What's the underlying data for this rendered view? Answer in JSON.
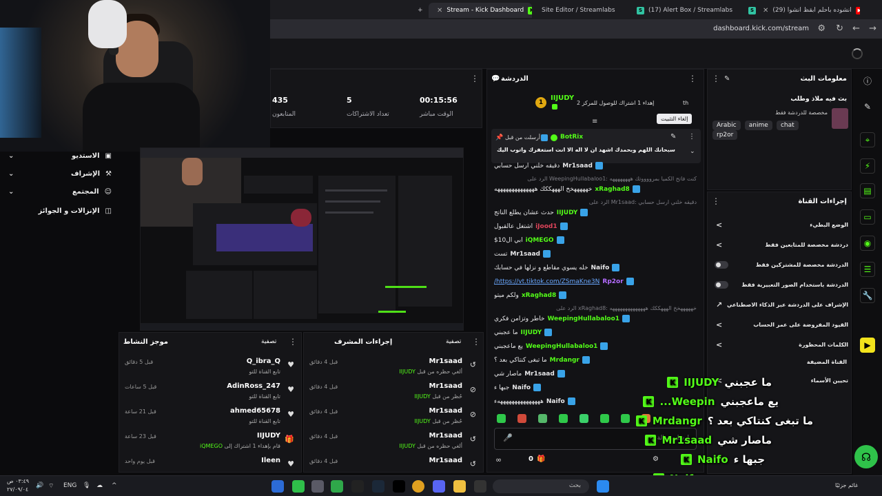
{
  "browser": {
    "tabs": [
      {
        "label": "Stream - Kick Dashboard",
        "favicon": "K",
        "active": true
      },
      {
        "label": "Site Editor / Streamlabs",
        "favicon": "S",
        "active": false
      },
      {
        "label": "(17) Alert Box / Streamlabs",
        "favicon": "S",
        "active": false
      },
      {
        "label": "(29) انشوده باحلم ابقظ انشوا",
        "favicon": "▶",
        "active": false
      }
    ],
    "new_tab": "+",
    "url": "dashboard.kick.com/stream"
  },
  "left_nav": {
    "items": [
      {
        "label": "الاستديو",
        "icon": "studio-icon"
      },
      {
        "label": "الإشراف",
        "icon": "moderation-icon"
      },
      {
        "label": "المجتمع",
        "icon": "community-icon"
      },
      {
        "label": "الإنزالات و الجوائز",
        "icon": "drops-icon"
      }
    ]
  },
  "stats": {
    "viewers": {
      "value": "435",
      "label": "المتابعون"
    },
    "subs": {
      "value": "5",
      "label": "تعداد الاشتراكات"
    },
    "uptime": {
      "value": "00:15:56",
      "label": "الوقت مباشر"
    }
  },
  "chat": {
    "title": "الدردشة",
    "goal_user": "IIJUDY",
    "goal_text": "إهداء 1 اشتراك للوصول للمركز 2",
    "goal_suffix": "th",
    "goal_rank": "1",
    "pinned": {
      "prefix": "أرسلت من قبل:",
      "user": "BotRix",
      "text": "سبحانك اللهم وبحمدك اشهد ان لا اله الا انت استغفرك واتوب اليك"
    },
    "tooltip": "إلغاء التثبيت",
    "messages": [
      {
        "type": "msg",
        "user": "Mr1saad",
        "text": "دقيقه خلني ارسل حسابي",
        "color": "#e8e8ea"
      },
      {
        "type": "reply",
        "text": "الرد على WeepingHullabaloo1: كنت فاتح الكميا بمرووووتك ههههههههه"
      },
      {
        "type": "msg",
        "user": "xRaghad8",
        "text": "خهههههخخ الهههككك ههههههههههههههه",
        "color": "#53fc18"
      },
      {
        "type": "reply",
        "text": "الرد على Mr1saad: دقيقه خلني ارسل حسابي"
      },
      {
        "type": "msg",
        "user": "IIJUDY",
        "text": "حدث عشان يطلع الناتج",
        "color": "#53fc18"
      },
      {
        "type": "msg",
        "user": "iJood1",
        "text": "اشتغل عالقبول",
        "color": "#e0445a"
      },
      {
        "type": "msg",
        "user": "iQMEGO",
        "text": "ابي ال10$",
        "color": "#53fc18"
      },
      {
        "type": "msg",
        "user": "Mr1saad",
        "text": "تست",
        "color": "#e8e8ea"
      },
      {
        "type": "msg",
        "user": "Naifo",
        "text": "خله يسوي مقاطع و نزلها في حسابك",
        "color": "#e8e8ea"
      },
      {
        "type": "msg",
        "user": "Rp2or",
        "text": "https://vt.tiktok.com/ZSmaKne3N/",
        "color": "#b56cff",
        "link": true
      },
      {
        "type": "msg",
        "user": "xRaghad8",
        "text": "ولكم ميتو",
        "color": "#53fc18"
      },
      {
        "type": "reply",
        "text": "الرد على xRaghad8: خهههههخخ الهههككك ههههههههههههههه"
      },
      {
        "type": "msg",
        "user": "WeepingHullabaloo1",
        "text": "خاطر وتزامن فكري",
        "color": "#53fc18"
      },
      {
        "type": "msg",
        "user": "IIJUDY",
        "text": "ما عجبني",
        "color": "#53fc18"
      },
      {
        "type": "msg",
        "user": "WeepingHullabaloo1",
        "text": "يع ماعجبني",
        "color": "#53fc18"
      },
      {
        "type": "msg",
        "user": "Mrdangr",
        "text": "ما تبغى كنتاكي بعد ؟",
        "color": "#53fc18"
      },
      {
        "type": "msg",
        "user": "Mr1saad",
        "text": "ماصار شي",
        "color": "#e8e8ea"
      },
      {
        "type": "msg",
        "user": "Naifo",
        "text": "جبها ء",
        "color": "#e8e8ea"
      },
      {
        "type": "msg",
        "user": "Naifo",
        "text": "ههههههههههههههههء",
        "color": "#e8e8ea"
      }
    ],
    "input_placeholder": "ارسل رسالة",
    "points": "0"
  },
  "stream_info": {
    "title": "معلومات البث",
    "stream_title": "بث فيه ملاذ وطلب",
    "category": "مخصصة للدردشة فقط",
    "tags": [
      "Arabic",
      "anime",
      "chat",
      "rp2or"
    ]
  },
  "channel_actions": {
    "title": "إجراءات القناة",
    "rows": [
      {
        "label": "الوضع البطيء",
        "control": "chevron"
      },
      {
        "label": "دردشة مخصصة للمتابعين فقط",
        "control": "chevron"
      },
      {
        "label": "الدردشة مخصصة للمشتركين فقط",
        "control": "toggle"
      },
      {
        "label": "الدردشة باستخدام الصور التعبيرية فقط",
        "control": "toggle"
      },
      {
        "label": "الإشراف على الدردشة عبر الذكاء الاصطناعي",
        "control": "external"
      },
      {
        "label": "القيود المفروضة على عمر الحساب",
        "control": "chevron"
      },
      {
        "label": "الكلمات المحظورة",
        "control": "chevron"
      }
    ],
    "custom_channel": "القناة المضيفة",
    "host_label": "تحيين الأسماء"
  },
  "activity": {
    "title": "موجز النشاط",
    "filter": "تصفية",
    "items": [
      {
        "user": "Q_ibra_Q",
        "sub": "تابع القناة للتو",
        "time": "قبل 5 دقائق",
        "icon": "heart-icon"
      },
      {
        "user": "AdinRoss_247",
        "sub": "تابع القناة للتو",
        "time": "قبل 5 ساعات",
        "icon": "heart-icon"
      },
      {
        "user": "ahmed65678",
        "sub": "تابع القناة للتو",
        "time": "قبل 21 ساعة",
        "icon": "heart-icon"
      },
      {
        "user": "IIJUDY",
        "sub": "قام بإهداء 1 اشتراك إلى",
        "sub_user": "iQMEGO",
        "time": "قبل 23 ساعة",
        "icon": "gift-icon"
      },
      {
        "user": "Ileen",
        "sub": "",
        "time": "قبل يوم واحد",
        "icon": "heart-icon"
      }
    ]
  },
  "mod_actions": {
    "title": "إجراءات المشرف",
    "filter": "تصفية",
    "items": [
      {
        "user": "Mr1saad",
        "sub": "ألغي حظره من قبل",
        "by": "IIJUDY",
        "time": "قبل 4 دقائق",
        "icon": "undo-icon"
      },
      {
        "user": "Mr1saad",
        "sub": "حُظر من قبل",
        "by": "IIJUDY",
        "time": "قبل 4 دقائق",
        "icon": "ban-icon"
      },
      {
        "user": "Mr1saad",
        "sub": "حُظر من قبل",
        "by": "IIJUDY",
        "time": "قبل 4 دقائق",
        "icon": "ban-icon"
      },
      {
        "user": "Mr1saad",
        "sub": "ألغي حظره من قبل",
        "by": "IIJUDY",
        "time": "قبل 4 دقائق",
        "icon": "undo-icon"
      },
      {
        "user": "Mr1saad",
        "sub": "",
        "by": "",
        "time": "قبل 4 دقائق",
        "icon": "undo-icon"
      }
    ]
  },
  "overlay": [
    {
      "user": "IIJUDY",
      "text": "ما عجبني"
    },
    {
      "user": "Weepin...",
      "text": "يع ماعجبني"
    },
    {
      "user": "Mrdangr",
      "text": "ما تبغى كنتاكي بعد ؟"
    },
    {
      "user": "Mr1saad",
      "text": "ماصار شي"
    },
    {
      "user": "Naifo",
      "text": "جبها ء"
    },
    {
      "user": "Naifo",
      "text": "ههههههههههههههههههء"
    }
  ],
  "taskbar": {
    "search_placeholder": "بحث",
    "lang": "ENG",
    "time": "٠٣:٤٩ ص",
    "date": "٢٧/٠٩/٠٤",
    "weather": "غائم جزئيًا"
  },
  "colors": {
    "kick_green": "#53fc18",
    "panel_bg": "#151518",
    "page_bg": "#0b0b0d"
  }
}
